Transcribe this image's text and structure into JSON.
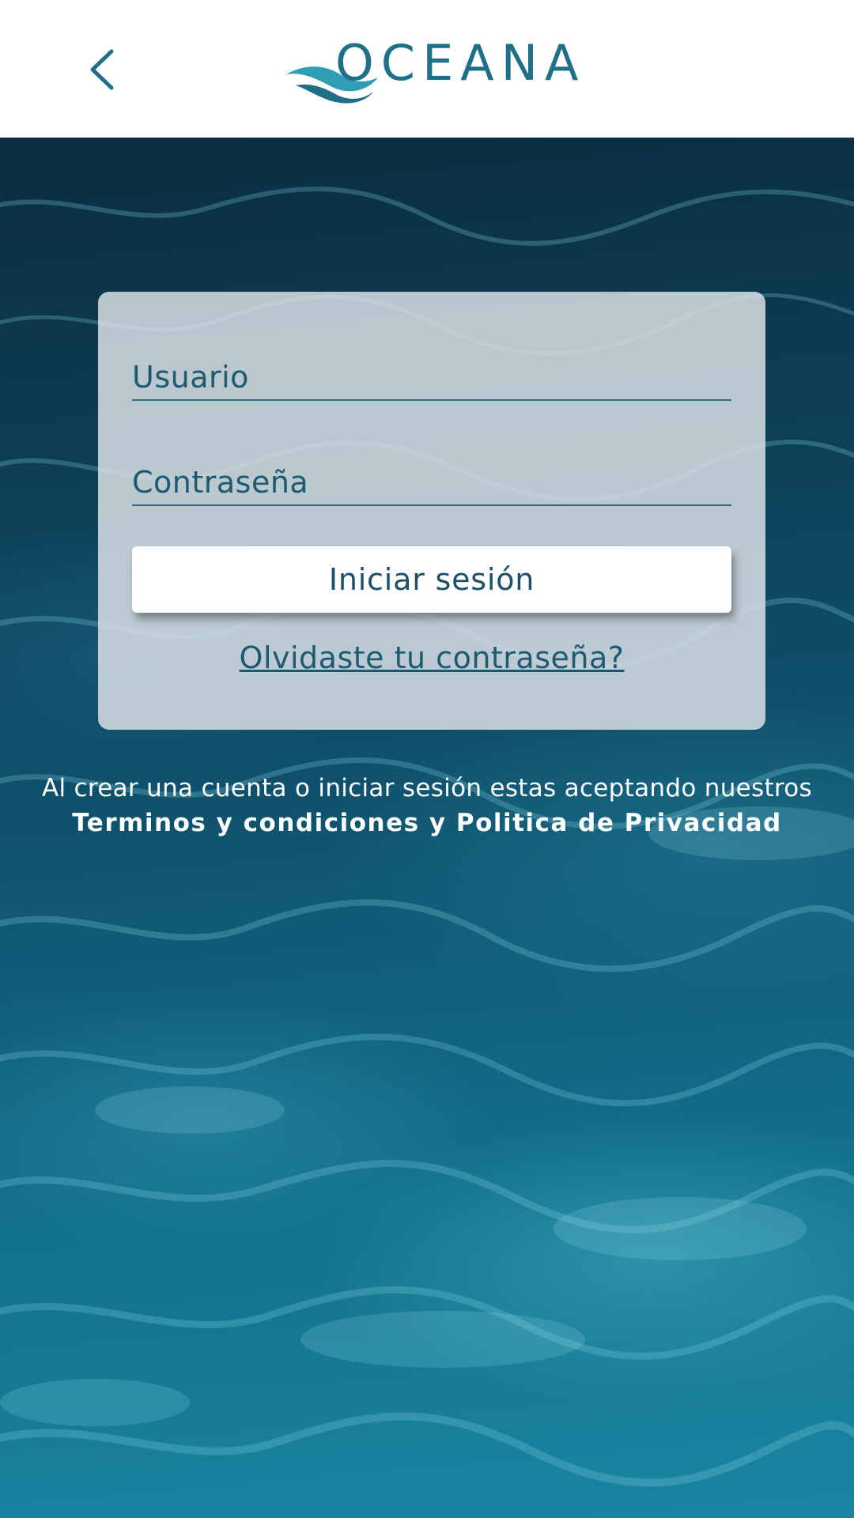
{
  "header": {
    "back_icon": "chevron-left-icon",
    "logo_text": "OCEANA",
    "logo_icon": "wave-icon"
  },
  "login_form": {
    "username_placeholder": "Usuario",
    "password_placeholder": "Contraseña",
    "submit_label": "Iniciar sesión",
    "forgot_password_label": "Olvidaste tu contraseña?"
  },
  "legal": {
    "notice": "Al crear una cuenta o iniciar sesión estas aceptando nuestros",
    "links_label": "Terminos y condiciones y Politica de Privacidad"
  },
  "colors": {
    "brand": "#1f6f88",
    "brand_light": "#3aa9b9",
    "card_background": "#d7dee4",
    "text_dark": "#1d5a70"
  }
}
